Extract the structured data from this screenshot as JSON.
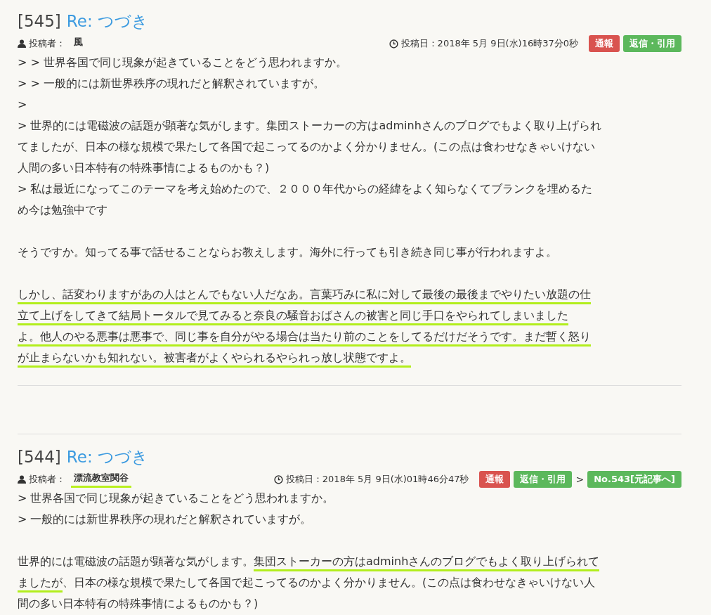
{
  "posts": [
    {
      "number": "[545]",
      "title": "Re: つづき",
      "author_label": "投稿者：",
      "author": {
        "name": "風",
        "underlined": false
      },
      "date": "投稿日：2018年 5月 9日(水)16時37分0秒",
      "actions": [
        {
          "kind": "report",
          "label": "通報"
        },
        {
          "kind": "reply",
          "label": "返信・引用"
        }
      ],
      "lines": [
        {
          "kind": "text",
          "segments": [
            {
              "text": "> > 世界各国で同じ現象が起きていることをどう思われますか。",
              "underlined": false
            }
          ]
        },
        {
          "kind": "text",
          "segments": [
            {
              "text": "> > 一般的には新世界秩序の現れだと解釈されていますが。",
              "underlined": false
            }
          ]
        },
        {
          "kind": "text",
          "segments": [
            {
              "text": ">",
              "underlined": false
            }
          ]
        },
        {
          "kind": "text",
          "segments": [
            {
              "text": "> 世界的には電磁波の話題が顕著な気がします。集団ストーカーの方はadminhさんのブログでもよく取り上げられ",
              "underlined": false
            }
          ]
        },
        {
          "kind": "text",
          "segments": [
            {
              "text": "てましたが、日本の様な規模で果たして各国で起こってるのかよく分かりません。(この点は食わせなきゃいけない",
              "underlined": false
            }
          ]
        },
        {
          "kind": "text",
          "segments": [
            {
              "text": "人間の多い日本特有の特殊事情によるものかも？)",
              "underlined": false
            }
          ]
        },
        {
          "kind": "text",
          "segments": [
            {
              "text": "> 私は最近になってこのテーマを考え始めたので、２０００年代からの経緯をよく知らなくてブランクを埋めるた",
              "underlined": false
            }
          ]
        },
        {
          "kind": "text",
          "segments": [
            {
              "text": "め今は勉強中です",
              "underlined": false
            }
          ]
        },
        {
          "kind": "blank"
        },
        {
          "kind": "text",
          "segments": [
            {
              "text": "そうですか。知ってる事で話せることならお教えします。海外に行っても引き続き同じ事が行われますよ。",
              "underlined": false
            }
          ]
        },
        {
          "kind": "blank"
        },
        {
          "kind": "text",
          "segments": [
            {
              "text": "しかし、話変わりますがあの人はとんでもない人だなあ。言葉巧みに私に対して最後の最後までやりたい放題の仕",
              "underlined": true
            }
          ]
        },
        {
          "kind": "text",
          "segments": [
            {
              "text": "立て上げをしてきて結局トータルで見てみると奈良の騒音おばさんの被害と同じ手口をやられてしまいました",
              "underlined": true
            }
          ]
        },
        {
          "kind": "text",
          "segments": [
            {
              "text": "よ。",
              "underlined": true
            },
            {
              "text": "他人のやる悪事は悪事で、同じ事を自分がやる場合は当たり前のことをしてるだけだそうです。まだ暫く怒り",
              "underlined": true
            }
          ]
        },
        {
          "kind": "text",
          "segments": [
            {
              "text": "が止まらないかも知れない。被害者がよくやられるやられっ放し状態ですよ。",
              "underlined": true
            }
          ]
        }
      ]
    },
    {
      "number": "[544]",
      "title": "Re: つづき",
      "author_label": "投稿者：",
      "author": {
        "name": "漂流教室関谷",
        "underlined": true
      },
      "date": "投稿日：2018年 5月 9日(水)01時46分47秒",
      "actions": [
        {
          "kind": "report",
          "label": "通報"
        },
        {
          "kind": "reply",
          "label": "返信・引用"
        },
        {
          "kind": "separator",
          "label": ">"
        },
        {
          "kind": "link",
          "label": "No.543[元記事へ]"
        }
      ],
      "lines": [
        {
          "kind": "text",
          "segments": [
            {
              "text": "> 世界各国で同じ現象が起きていることをどう思われますか。",
              "underlined": false
            }
          ]
        },
        {
          "kind": "text",
          "segments": [
            {
              "text": "> 一般的には新世界秩序の現れだと解釈されていますが。",
              "underlined": false
            }
          ]
        },
        {
          "kind": "blank"
        },
        {
          "kind": "text",
          "segments": [
            {
              "text": "世界的には電磁波の話題が顕著な気がします。",
              "underlined": false
            },
            {
              "text": "集団ストーカーの方はadminhさんのブログでもよく取り上げられて",
              "underlined": true
            }
          ]
        },
        {
          "kind": "text",
          "segments": [
            {
              "text": "ましたが",
              "underlined": true
            },
            {
              "text": "、日本の様な規模で果たして各国で起こってるのかよく分かりません。(この点は食わせなきゃいけない人",
              "underlined": false
            }
          ]
        },
        {
          "kind": "text",
          "segments": [
            {
              "text": "間の多い日本特有の特殊事情によるものかも？)",
              "underlined": false
            }
          ]
        }
      ]
    }
  ]
}
